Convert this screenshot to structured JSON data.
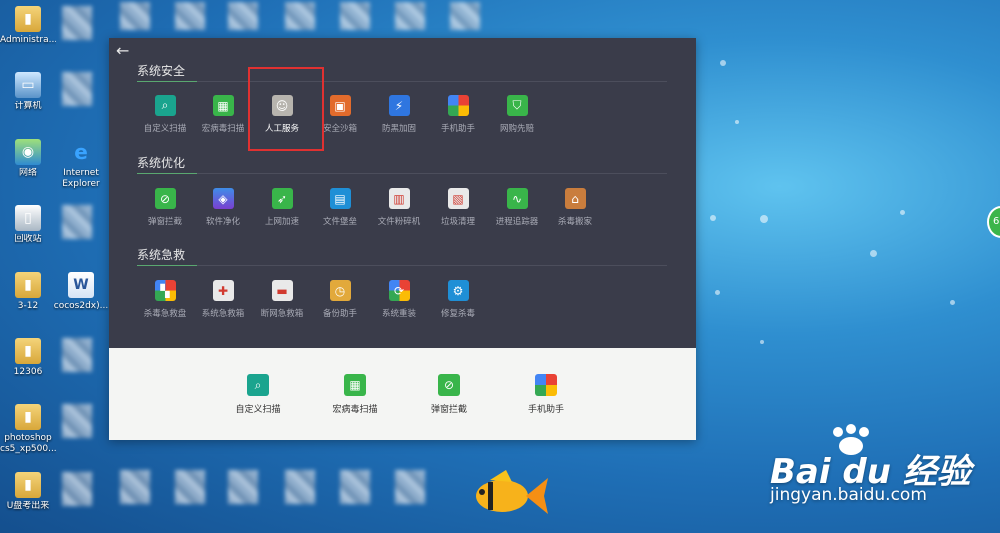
{
  "desktop_icons": [
    {
      "label": "Administra...",
      "glyph": "▮",
      "style": "folder"
    },
    {
      "label": "计算机",
      "glyph": "▭",
      "style": "pc"
    },
    {
      "label": "网络",
      "glyph": "◉",
      "style": "net"
    },
    {
      "label": "Internet Explorer",
      "glyph": "e",
      "style": "ie"
    },
    {
      "label": "回收站",
      "glyph": "▯",
      "style": "bin"
    },
    {
      "label": "3-12",
      "glyph": "▮",
      "style": "folder"
    },
    {
      "label": "cocos2dx)...",
      "glyph": "W",
      "style": "word"
    },
    {
      "label": "12306",
      "glyph": "▮",
      "style": "folder"
    },
    {
      "label": "photoshop cs5_xp500...",
      "glyph": "▮",
      "style": "folder"
    },
    {
      "label": "U盘考出来",
      "glyph": "▮",
      "style": "folder"
    }
  ],
  "sections": {
    "security": {
      "title": "系统安全",
      "items": [
        {
          "label": "自定义扫描",
          "icon": "scan-icon",
          "glyph": "⌕",
          "style": "teal"
        },
        {
          "label": "宏病毒扫描",
          "icon": "macro-scan-icon",
          "glyph": "▦",
          "style": "green"
        },
        {
          "label": "人工服务",
          "icon": "support-agent-icon",
          "glyph": "☺",
          "style": "grey"
        },
        {
          "label": "安全沙箱",
          "icon": "sandbox-icon",
          "glyph": "▣",
          "style": "orange"
        },
        {
          "label": "防黑加固",
          "icon": "lightning-icon",
          "glyph": "⚡",
          "style": "blue"
        },
        {
          "label": "手机助手",
          "icon": "phone-assistant-icon",
          "glyph": "",
          "style": "multi"
        },
        {
          "label": "网购先赔",
          "icon": "shield-icon",
          "glyph": "⛉",
          "style": "green"
        }
      ]
    },
    "optimize": {
      "title": "系统优化",
      "items": [
        {
          "label": "弹窗拦截",
          "icon": "popup-block-icon",
          "glyph": "⊘",
          "style": "green"
        },
        {
          "label": "软件净化",
          "icon": "layers-icon",
          "glyph": "◈",
          "style": "purple"
        },
        {
          "label": "上网加速",
          "icon": "rocket-icon",
          "glyph": "➶",
          "style": "green"
        },
        {
          "label": "文件堡垒",
          "icon": "file-vault-icon",
          "glyph": "▤",
          "style": "cyan"
        },
        {
          "label": "文件粉碎机",
          "icon": "shredder-icon",
          "glyph": "▥",
          "style": "white"
        },
        {
          "label": "垃圾清理",
          "icon": "cleanup-icon",
          "glyph": "▧",
          "style": "white"
        },
        {
          "label": "进程追踪器",
          "icon": "process-tracker-icon",
          "glyph": "∿",
          "style": "green"
        },
        {
          "label": "杀毒搬家",
          "icon": "house-icon",
          "glyph": "⌂",
          "style": "brown"
        }
      ]
    },
    "rescue": {
      "title": "系统急救",
      "items": [
        {
          "label": "杀毒急救盘",
          "icon": "rescue-disk-icon",
          "glyph": "▚",
          "style": "multi-square"
        },
        {
          "label": "系统急救箱",
          "icon": "first-aid-icon",
          "glyph": "✚",
          "style": "white"
        },
        {
          "label": "断网急救箱",
          "icon": "network-aid-icon",
          "glyph": "▬",
          "style": "white"
        },
        {
          "label": "备份助手",
          "icon": "backup-icon",
          "glyph": "◷",
          "style": "amber"
        },
        {
          "label": "系统重装",
          "icon": "reinstall-icon",
          "glyph": "⟳",
          "style": "multi-square"
        },
        {
          "label": "修复杀毒",
          "icon": "repair-icon",
          "glyph": "⚙",
          "style": "cyan"
        }
      ]
    }
  },
  "quick_tools": [
    {
      "label": "自定义扫描",
      "icon": "scan-icon",
      "glyph": "⌕",
      "style": "teal"
    },
    {
      "label": "宏病毒扫描",
      "icon": "macro-scan-icon",
      "glyph": "▦",
      "style": "green"
    },
    {
      "label": "弹窗拦截",
      "icon": "popup-block-icon",
      "glyph": "⊘",
      "style": "green"
    },
    {
      "label": "手机助手",
      "icon": "phone-assistant-icon",
      "glyph": "",
      "style": "multi"
    }
  ],
  "highlighted_item": "人工服务",
  "watermark": {
    "main": "Bai du 经验",
    "sub": "jingyan.baidu.com"
  },
  "side_badge": "6"
}
